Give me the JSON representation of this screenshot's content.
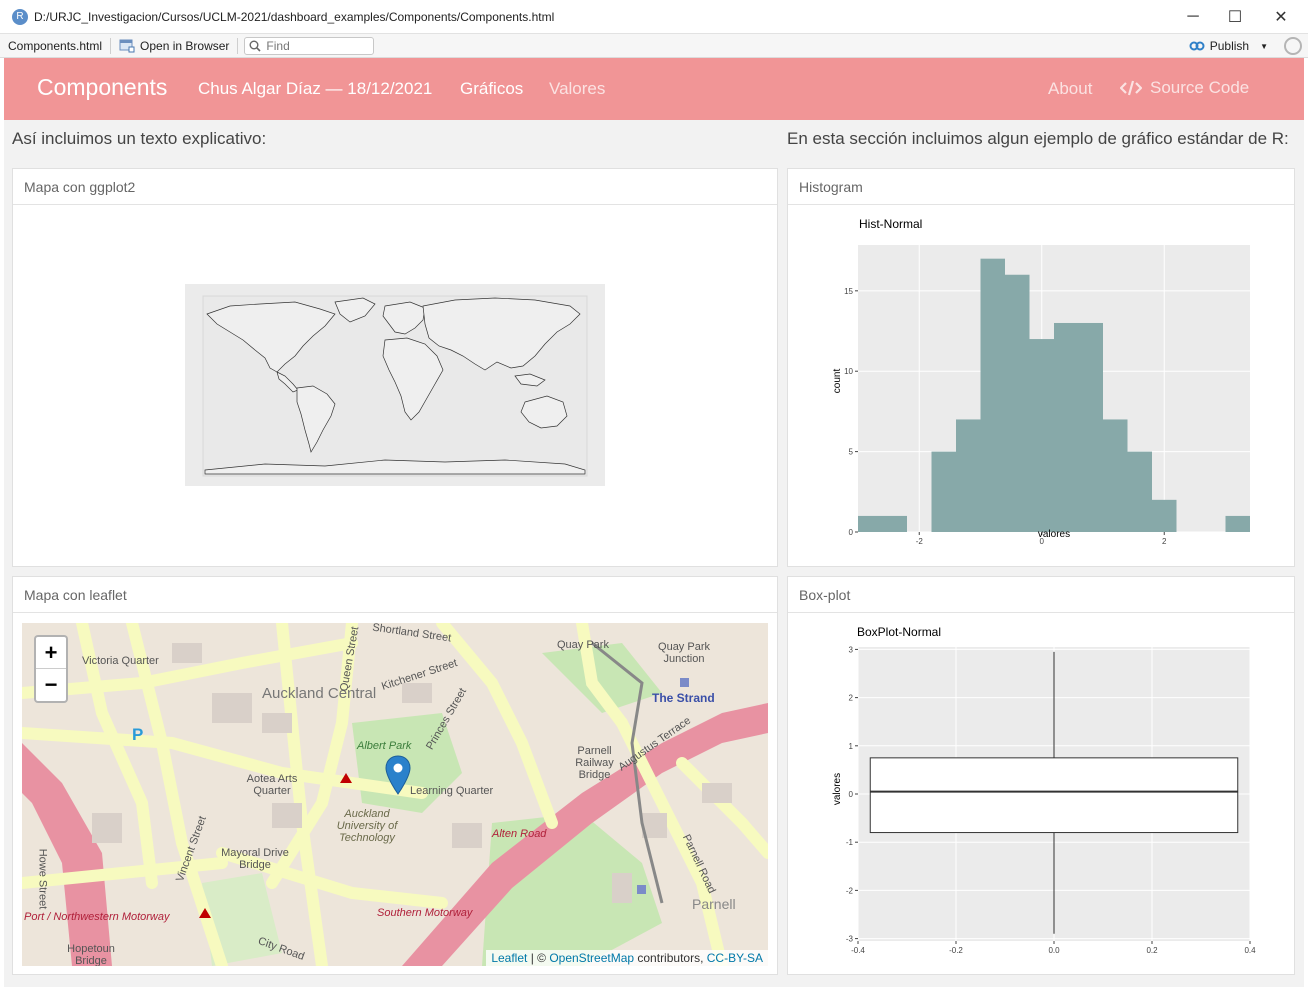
{
  "window": {
    "icon_letter": "R",
    "title": "D:/URJC_Investigacion/Cursos/UCLM-2021/dashboard_examples/Components/Components.html",
    "minimize": "─",
    "maximize": "☐",
    "close": "✕"
  },
  "toolbar": {
    "file_tab": "Components.html",
    "open_browser": "Open in Browser",
    "find_placeholder": "Find",
    "publish": "Publish"
  },
  "navbar": {
    "brand": "Components",
    "author": "Chus Algar Díaz — 18/12/2021",
    "tabs": [
      "Gráficos",
      "Valores"
    ],
    "about": "About",
    "source_code": "Source Code"
  },
  "intro": {
    "left": "Así incluimos un texto explicativo:",
    "right": "En esta sección incluimos algun ejemplo de gráfico estándar de R:"
  },
  "cards": {
    "ggplot_map": "Mapa con ggplot2",
    "histogram": "Histogram",
    "leaflet_map": "Mapa con leaflet",
    "boxplot": "Box-plot"
  },
  "leaflet": {
    "zoom_in": "+",
    "zoom_out": "−",
    "attribution_leaflet": "Leaflet",
    "attribution_sep": " | © ",
    "attribution_osm": "OpenStreetMap",
    "attribution_contrib": " contributors, ",
    "attribution_license": "CC-BY-SA",
    "labels": [
      "Auckland Central",
      "Victoria Quarter",
      "Aotea Arts Quarter",
      "Learning Quarter",
      "Albert Park",
      "Auckland University of Technology",
      "Mayoral Drive Bridge",
      "Quay Park",
      "Quay Park Junction",
      "The Strand",
      "Parnell Railway Bridge",
      "Parnell",
      "Alten Road",
      "Southern Motorway",
      "Port / Northwestern Motorway",
      "Hopetoun Bridge",
      "Howe Street",
      "Vincent Street",
      "Queen Street",
      "Shortland Street",
      "Kitchener Street",
      "Princes Street",
      "City Road",
      "Augustus Terrace",
      "Parnell Road"
    ],
    "colors": {
      "tile_bg": "#ede5da",
      "road": "#f7fabf",
      "motorway": "#e892a2",
      "park": "#c8facc",
      "marker": "#2a81cb"
    }
  },
  "charts_colors": {
    "hist_fill": "#87a9a9",
    "panel_bg": "#ebebeb",
    "grid": "#ffffff"
  },
  "chart_data": [
    {
      "type": "bar",
      "title": "Hist-Normal",
      "xlabel": "valores",
      "ylabel": "count",
      "bins_start": [
        -3.0,
        -2.6,
        -2.2,
        -1.8,
        -1.4,
        -1.0,
        -0.6,
        -0.2,
        0.2,
        0.6,
        1.0,
        1.4,
        1.8,
        2.2,
        2.6,
        3.0
      ],
      "bin_width": 0.4,
      "values": [
        1,
        1,
        0,
        5,
        7,
        17,
        16,
        12,
        13,
        13,
        7,
        5,
        2,
        0,
        0,
        1
      ],
      "xlim": [
        -3.0,
        3.4
      ],
      "ylim": [
        0,
        17.85
      ],
      "xticks": [
        -2,
        0,
        2
      ],
      "yticks": [
        0,
        5,
        10,
        15
      ],
      "grid": true
    },
    {
      "type": "boxplot",
      "title": "BoxPlot-Normal",
      "xlabel": "",
      "ylabel": "valores",
      "min": -2.9,
      "q1": -0.8,
      "median": 0.05,
      "q3": 0.75,
      "max": 2.95,
      "box_x": [
        -0.375,
        0.375
      ],
      "xlim": [
        -0.4,
        0.4
      ],
      "ylim": [
        -3.05,
        3.05
      ],
      "xticks": [
        -0.4,
        -0.2,
        0.0,
        0.2,
        0.4
      ],
      "xtick_labels": [
        "-0.4",
        "-0.2",
        "0.0",
        "0.2",
        "0.4"
      ],
      "yticks": [
        -3,
        -2,
        -1,
        0,
        1,
        2,
        3
      ],
      "grid": true
    }
  ]
}
